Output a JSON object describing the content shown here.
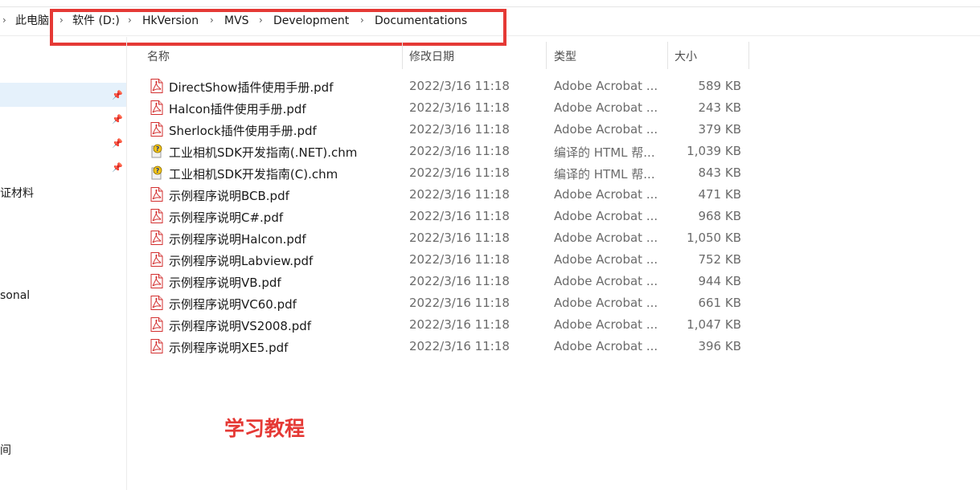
{
  "breadcrumb": {
    "root": "此电脑",
    "items": [
      "软件 (D:)",
      "HkVersion",
      "MVS",
      "Development",
      "Documentations"
    ]
  },
  "nav": {
    "items": [
      "证材料",
      "sonal",
      "间"
    ]
  },
  "columns": {
    "name": "名称",
    "date": "修改日期",
    "type": "类型",
    "size": "大小"
  },
  "files": [
    {
      "name": "DirectShow插件使用手册.pdf",
      "date": "2022/3/16 11:18",
      "type": "Adobe Acrobat ...",
      "size": "589 KB",
      "icon": "pdf-icon"
    },
    {
      "name": "Halcon插件使用手册.pdf",
      "date": "2022/3/16 11:18",
      "type": "Adobe Acrobat ...",
      "size": "243 KB",
      "icon": "pdf-icon"
    },
    {
      "name": "Sherlock插件使用手册.pdf",
      "date": "2022/3/16 11:18",
      "type": "Adobe Acrobat ...",
      "size": "379 KB",
      "icon": "pdf-icon"
    },
    {
      "name": "工业相机SDK开发指南(.NET).chm",
      "date": "2022/3/16 11:18",
      "type": "编译的 HTML 帮...",
      "size": "1,039 KB",
      "icon": "chm-help-icon"
    },
    {
      "name": "工业相机SDK开发指南(C).chm",
      "date": "2022/3/16 11:18",
      "type": "编译的 HTML 帮...",
      "size": "843 KB",
      "icon": "chm-help-icon"
    },
    {
      "name": "示例程序说明BCB.pdf",
      "date": "2022/3/16 11:18",
      "type": "Adobe Acrobat ...",
      "size": "471 KB",
      "icon": "pdf-icon"
    },
    {
      "name": "示例程序说明C#.pdf",
      "date": "2022/3/16 11:18",
      "type": "Adobe Acrobat ...",
      "size": "968 KB",
      "icon": "pdf-icon"
    },
    {
      "name": "示例程序说明Halcon.pdf",
      "date": "2022/3/16 11:18",
      "type": "Adobe Acrobat ...",
      "size": "1,050 KB",
      "icon": "pdf-icon"
    },
    {
      "name": "示例程序说明Labview.pdf",
      "date": "2022/3/16 11:18",
      "type": "Adobe Acrobat ...",
      "size": "752 KB",
      "icon": "pdf-icon"
    },
    {
      "name": "示例程序说明VB.pdf",
      "date": "2022/3/16 11:18",
      "type": "Adobe Acrobat ...",
      "size": "944 KB",
      "icon": "pdf-icon"
    },
    {
      "name": "示例程序说明VC60.pdf",
      "date": "2022/3/16 11:18",
      "type": "Adobe Acrobat ...",
      "size": "661 KB",
      "icon": "pdf-icon"
    },
    {
      "name": "示例程序说明VS2008.pdf",
      "date": "2022/3/16 11:18",
      "type": "Adobe Acrobat ...",
      "size": "1,047 KB",
      "icon": "pdf-icon"
    },
    {
      "name": "示例程序说明XE5.pdf",
      "date": "2022/3/16 11:18",
      "type": "Adobe Acrobat ...",
      "size": "396 KB",
      "icon": "pdf-icon"
    }
  ],
  "annotation": "学习教程",
  "colors": {
    "highlight": "#e53935",
    "selection": "#e5f1fb",
    "pdf": "#d32f2f",
    "chm": "#f5c518"
  }
}
